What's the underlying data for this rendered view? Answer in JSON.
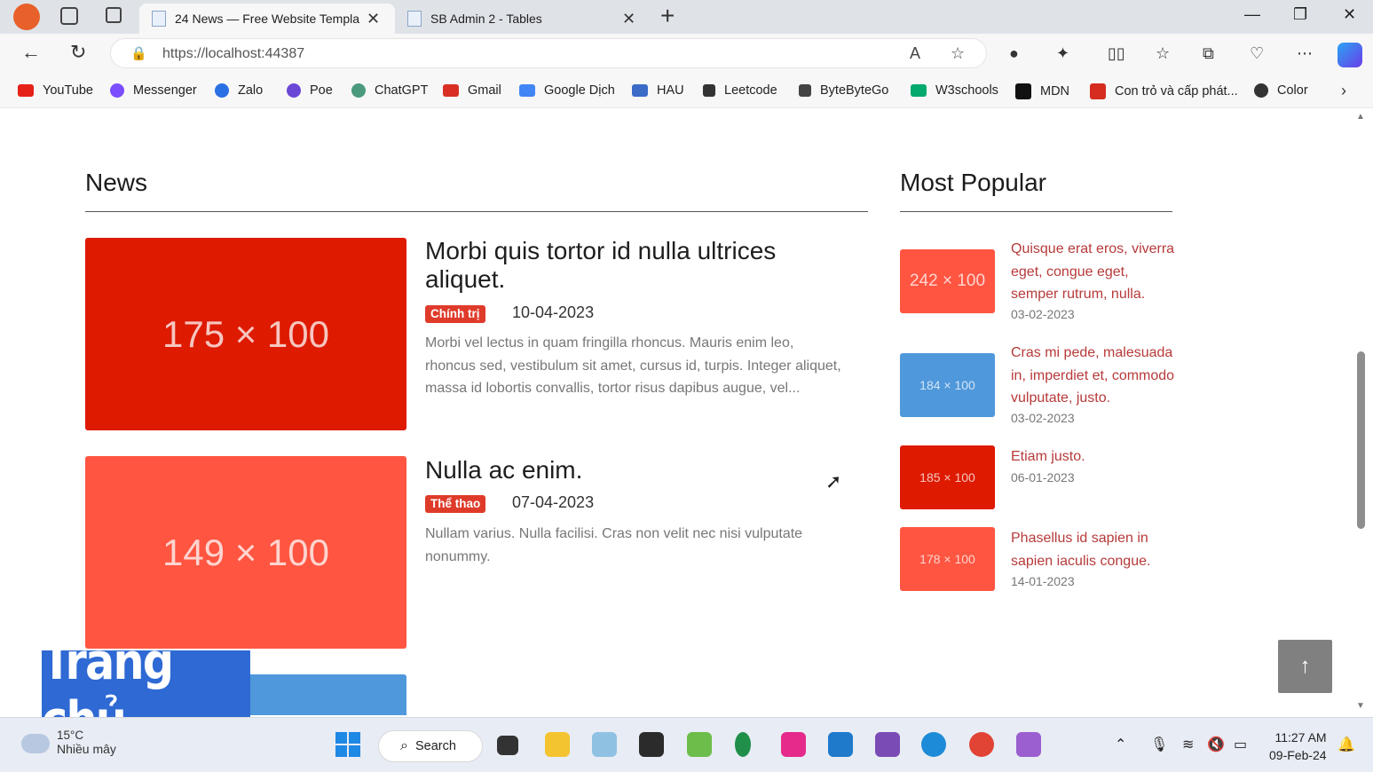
{
  "browser": {
    "tabs": [
      {
        "title": "24 News — Free Website Templa",
        "active": true
      },
      {
        "title": "SB Admin 2 - Tables",
        "active": false
      }
    ],
    "new_tab": "+",
    "url": "https://localhost:44387",
    "bookmarks": [
      {
        "label": "YouTube",
        "color": "#e62117"
      },
      {
        "label": "Messenger",
        "color": "#7b4dff"
      },
      {
        "label": "Zalo",
        "color": "#2a6fe3"
      },
      {
        "label": "Poe",
        "color": "#6b48d6"
      },
      {
        "label": "ChatGPT",
        "color": "#4a9a7d"
      },
      {
        "label": "Gmail",
        "color": "#d93025"
      },
      {
        "label": "Google Dịch",
        "color": "#4285f4"
      },
      {
        "label": "HAU",
        "color": "#3a6cc7"
      },
      {
        "label": "Leetcode",
        "color": "#333333"
      },
      {
        "label": "ByteByteGo",
        "color": "#444444"
      },
      {
        "label": "W3schools",
        "color": "#04aa6d"
      },
      {
        "label": "MDN",
        "color": "#111111"
      },
      {
        "label": "Con trỏ và cấp phát...",
        "color": "#d62b1f"
      },
      {
        "label": "Color",
        "color": "#333333"
      }
    ]
  },
  "news": {
    "section_title": "News",
    "articles": [
      {
        "placeholder": "175 × 100",
        "title_line1": "Morbi quis tortor id nulla ultrices",
        "title_line2": "aliquet.",
        "category": "Chính trị",
        "date": "10-04-2023",
        "excerpt_line1": "Morbi vel lectus in quam fringilla rhoncus. Mauris enim leo,",
        "excerpt_line2": "rhoncus sed, vestibulum sit amet, cursus id, turpis. Integer aliquet,",
        "excerpt_line3": "massa id lobortis convallis, tortor risus dapibus augue, vel...",
        "color": "#de1a00"
      },
      {
        "placeholder": "149 × 100",
        "title_line1": "Nulla ac enim.",
        "category": "Thể thao",
        "date": "07-04-2023",
        "excerpt_line1": "Nullam varius. Nulla facilisi. Cras non velit nec nisi vulputate",
        "excerpt_line2": "nonummy.",
        "color": "#ff5541"
      }
    ]
  },
  "popular": {
    "section_title": "Most Popular",
    "items": [
      {
        "placeholder": "242 × 100",
        "title_line1": "Quisque erat eros, viverra",
        "title_line2": "eget, congue eget,",
        "title_line3": "semper rutrum, nulla.",
        "date": "03-02-2023",
        "color": "#ff5541"
      },
      {
        "placeholder": "184 × 100",
        "title_line1": "Cras mi pede, malesuada",
        "title_line2": "in, imperdiet et, commodo",
        "title_line3": "vulputate, justo.",
        "date": "03-02-2023",
        "color": "#4f98db"
      },
      {
        "placeholder": "185 × 100",
        "title_line1": "Etiam justo.",
        "date": "06-01-2023",
        "color": "#de1a00"
      },
      {
        "placeholder": "178 × 100",
        "title_line1": "Phasellus id sapien in",
        "title_line2": "sapien iaculis congue.",
        "date": "14-01-2023",
        "color": "#ff5541"
      }
    ]
  },
  "overlay_caption": "Trang chủ",
  "back_to_top": "↑",
  "taskbar": {
    "weather_temp": "15°C",
    "weather_desc": "Nhiều mây",
    "search_label": "Search",
    "time": "11:27 AM",
    "date": "09-Feb-24"
  }
}
